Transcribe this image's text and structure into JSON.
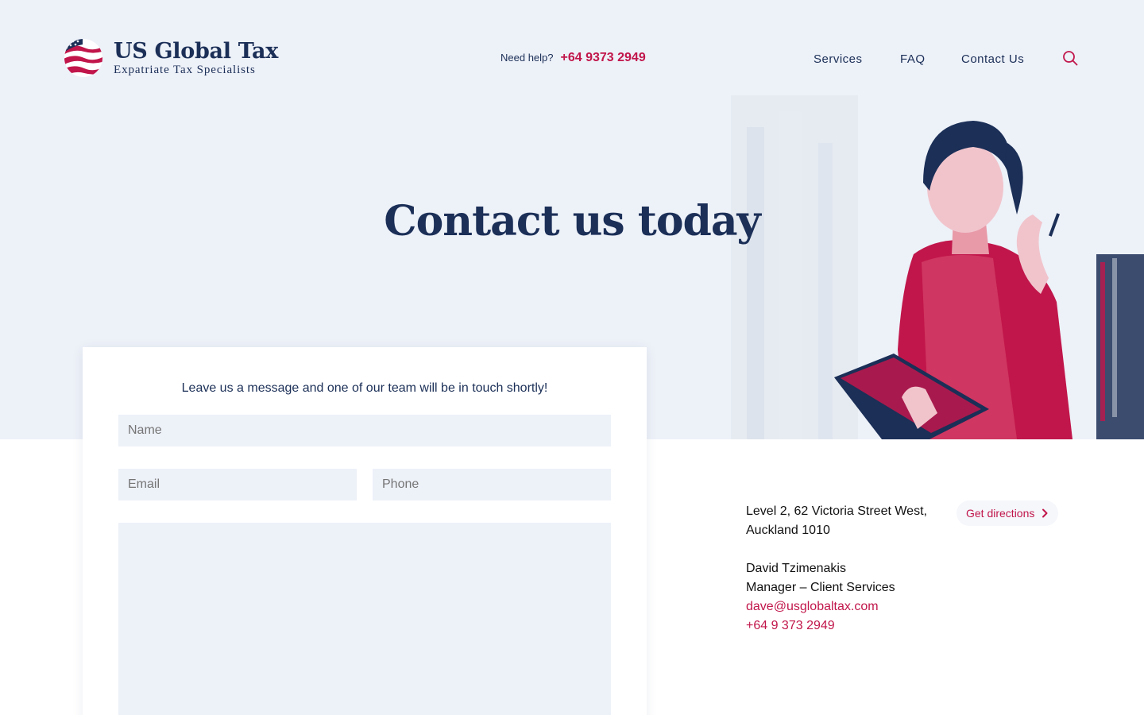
{
  "brand": {
    "name": "US Global Tax",
    "tagline": "Expatriate Tax Specialists"
  },
  "header": {
    "help_label": "Need help?",
    "help_phone": "+64 9373 2949",
    "nav": [
      "Services",
      "FAQ",
      "Contact Us"
    ]
  },
  "hero": {
    "title": "Contact us today"
  },
  "form": {
    "intro": "Leave us a message and one of our team will be in touch shortly!",
    "name_placeholder": "Name",
    "email_placeholder": "Email",
    "phone_placeholder": "Phone",
    "message_placeholder": ""
  },
  "contact": {
    "address_line1": "Level 2, 62 Victoria Street West,",
    "address_line2": "Auckland 1010",
    "directions_label": "Get directions",
    "person_name": "David Tzimenakis",
    "person_role": "Manager – Client Services",
    "email": "dave@usglobaltax.com",
    "phone": "+64 9 373 2949"
  },
  "colors": {
    "navy": "#1b2f57",
    "accent": "#c1164b",
    "hero_bg": "#edf1f8",
    "field_bg": "#edf1f8"
  },
  "icons": {
    "logo": "us-flag-globe-icon",
    "search": "search-icon",
    "directions": "chevron-right-icon"
  }
}
